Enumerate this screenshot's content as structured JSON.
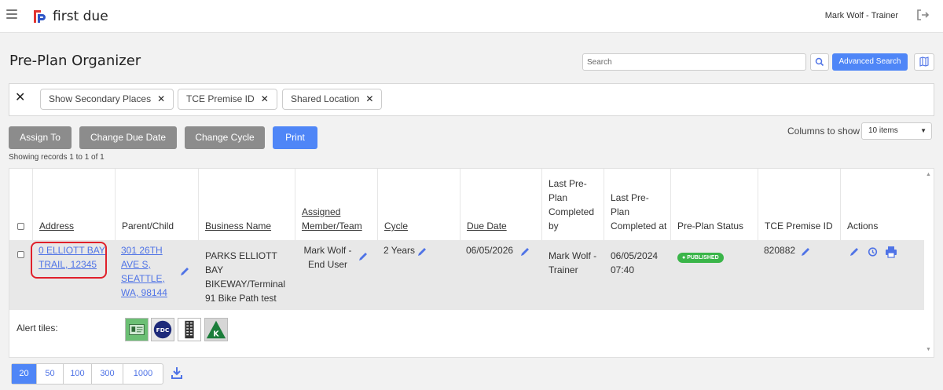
{
  "header": {
    "logo_text": "first due",
    "user": "Mark Wolf - Trainer"
  },
  "page": {
    "title": "Pre-Plan Organizer"
  },
  "search": {
    "placeholder": "Search",
    "advanced_label": "Advanced Search"
  },
  "filters": {
    "chips": [
      "Show Secondary Places",
      "TCE Premise ID",
      "Shared Location"
    ]
  },
  "actions": {
    "assign": "Assign To",
    "due_date": "Change Due Date",
    "cycle": "Change Cycle",
    "print": "Print"
  },
  "columns": {
    "label": "Columns to show",
    "selected": "10 items"
  },
  "showing": "Showing records 1 to 1 of 1",
  "table": {
    "headers": {
      "address": "Address",
      "parent": "Parent/Child",
      "business": "Business Name",
      "assigned": "Assigned Member/Team",
      "cycle": "Cycle",
      "due": "Due Date",
      "completed_by": "Last Pre-Plan Completed by",
      "completed_at": "Last Pre-Plan Completed at",
      "status": "Pre-Plan Status",
      "tce": "TCE Premise ID",
      "actions": "Actions"
    },
    "row": {
      "address": "0 ELLIOTT BAY TRAIL, 12345",
      "parent": "301 26TH AVE S, SEATTLE, WA, 98144",
      "business": "PARKS ELLIOTT BAY BIKEWAY/Terminal 91 Bike Path test",
      "assigned": "Mark Wolf - End User",
      "cycle": "2 Years",
      "due": "06/05/2026",
      "completed_by": "Mark Wolf - Trainer",
      "completed_at": "06/05/2024 07:40",
      "status": "PUBLISHED",
      "tce": "820882"
    },
    "alert_label": "Alert tiles:",
    "alert_tiles": [
      "id-card-icon",
      "fdc-icon",
      "building-icon",
      "knox-box-icon"
    ]
  },
  "pagination": {
    "sizes": [
      "20",
      "50",
      "100",
      "300",
      "1000"
    ],
    "active": "20"
  },
  "colors": {
    "accent": "#4f86f7",
    "link": "#4f73e6",
    "published": "#3ab549",
    "gray_button": "#8c8c8c",
    "highlight": "#e0202a"
  }
}
